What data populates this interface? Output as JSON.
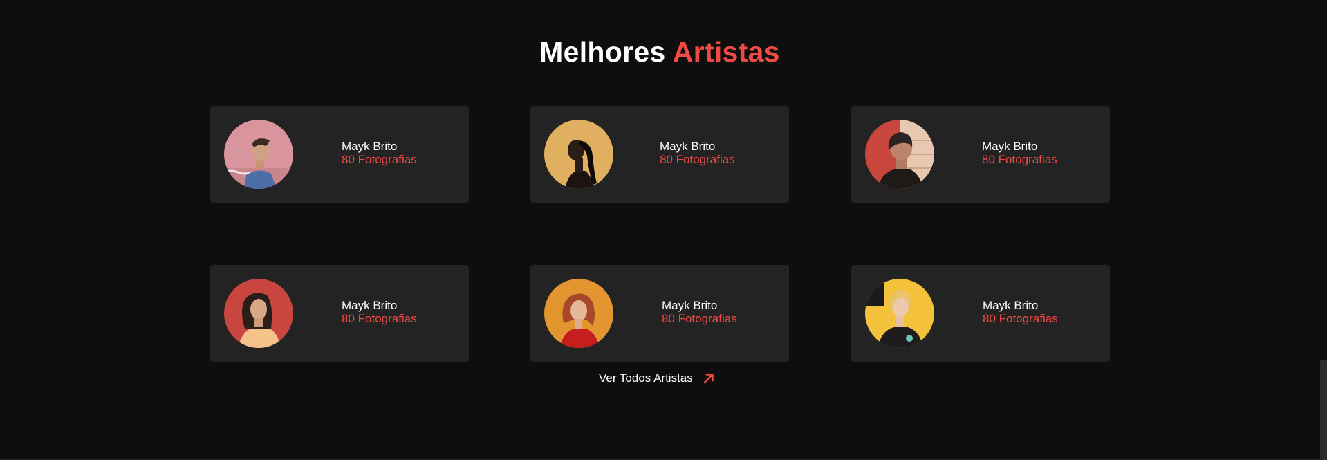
{
  "section": {
    "title_main": "Melhores",
    "title_accent": "Artistas"
  },
  "artists": [
    {
      "name": "Mayk Brito",
      "count": "80 Fotografias"
    },
    {
      "name": "Mayk Brito",
      "count": "80 Fotografias"
    },
    {
      "name": "Mayk Brito",
      "count": "80 Fotografias"
    },
    {
      "name": "Mayk Brito",
      "count": "80 Fotografias"
    },
    {
      "name": "Mayk Brito",
      "count": "80 Fotografias"
    },
    {
      "name": "Mayk Brito",
      "count": "80 Fotografias"
    }
  ],
  "view_all": {
    "label": "Ver Todos Artistas",
    "icon": "arrow-up-right-icon"
  },
  "colors": {
    "background": "#0e0e0e",
    "card": "#232323",
    "accent": "#ef4a43",
    "text": "#ffffff"
  }
}
